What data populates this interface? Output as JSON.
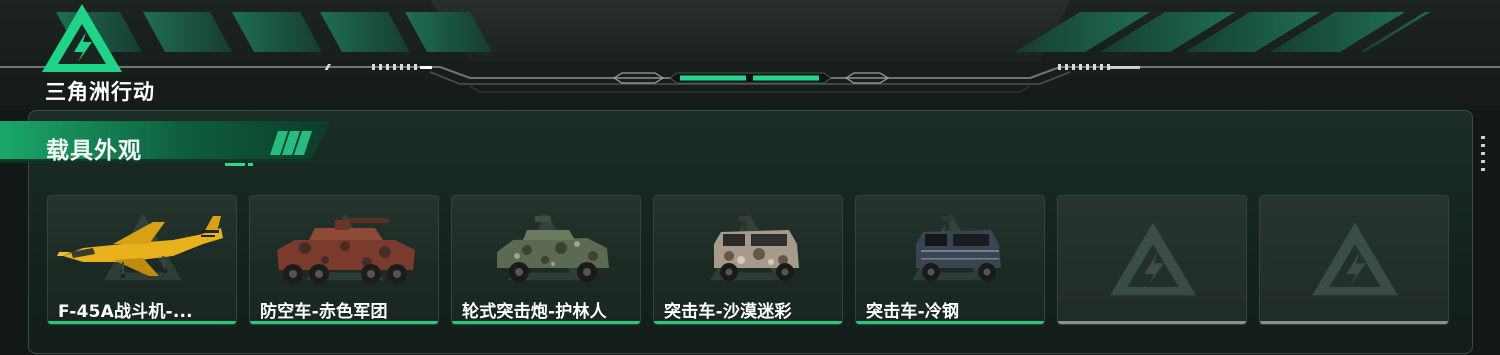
{
  "logo": {
    "text": "三角洲行动"
  },
  "section": {
    "title": "载具外观"
  },
  "cards": [
    {
      "name": "F-45A战斗机-...",
      "vehicle": "fighter-jet",
      "skin": "yellow"
    },
    {
      "name": "防空车-赤色军团",
      "vehicle": "anti-air-vehicle",
      "skin": "red-camo"
    },
    {
      "name": "轮式突击炮-护林人",
      "vehicle": "wheeled-assault-gun",
      "skin": "green-camo"
    },
    {
      "name": "突击车-沙漠迷彩",
      "vehicle": "assault-vehicle",
      "skin": "desert-camo"
    },
    {
      "name": "突击车-冷钢",
      "vehicle": "assault-vehicle",
      "skin": "cold-steel"
    },
    {
      "name": "",
      "vehicle": "empty-slot",
      "skin": ""
    },
    {
      "name": "",
      "vehicle": "empty-slot",
      "skin": ""
    }
  ],
  "colors": {
    "accent": "#22c97a",
    "empty_underline": "#8a918e",
    "panel_bg": "#17271f",
    "logo_green": "#1fd488"
  }
}
